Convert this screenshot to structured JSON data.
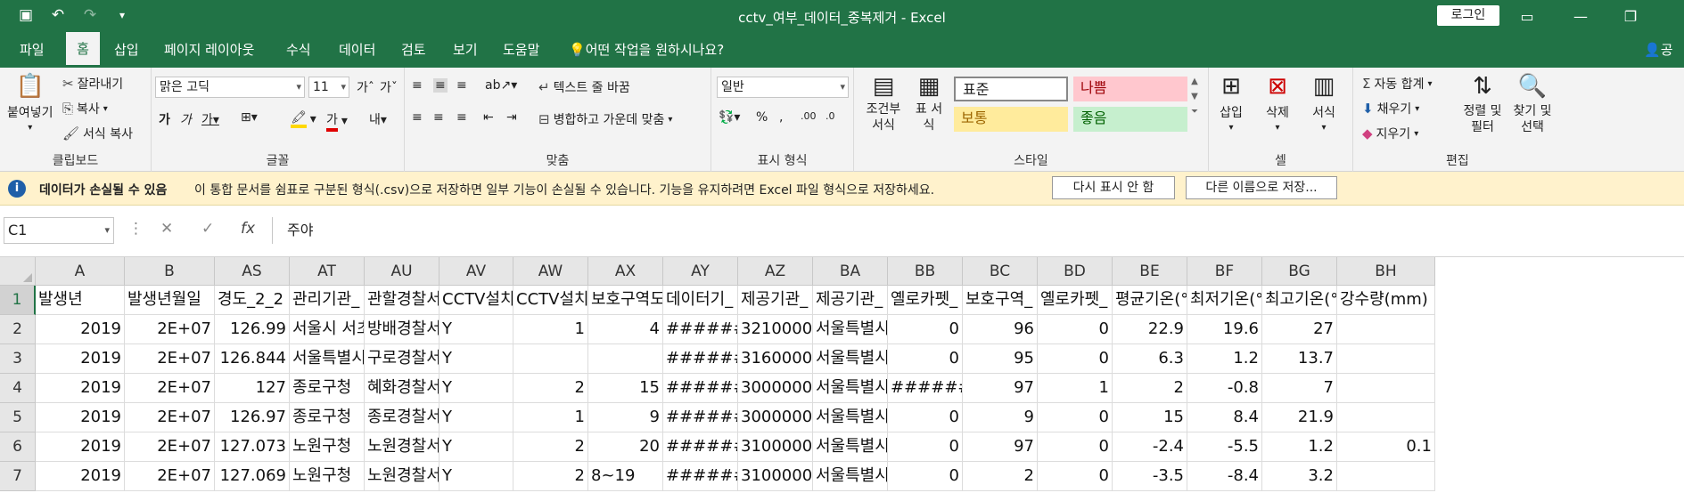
{
  "window": {
    "title": "cctv_여부_데이터_중복제거  -  Excel",
    "login_label": "로그인",
    "qat_icons": [
      "save-icon",
      "undo-icon",
      "redo-icon",
      "customize-qat-icon"
    ]
  },
  "ribbon_tabs": [
    "파일",
    "홈",
    "삽입",
    "페이지 레이아웃",
    "수식",
    "데이터",
    "검토",
    "보기",
    "도움말",
    "어떤 작업을 원하시나요?",
    "공유"
  ],
  "active_tab": "홈",
  "ribbon": {
    "clipboard": {
      "paste": "붙여넣기",
      "cut": "잘라내기",
      "copy": "복사",
      "format_painter": "서식 복사",
      "label": "클립보드"
    },
    "font": {
      "name": "맑은 고딕",
      "size": "11",
      "label": "글꼴"
    },
    "alignment": {
      "wrap": "텍스트 줄 바꿈",
      "merge": "병합하고 가운데 맞춤",
      "label": "맞춤"
    },
    "number": {
      "format": "일반",
      "label": "표시 형식"
    },
    "styles": {
      "conditional": "조건부 서식",
      "table": "표 서식",
      "normal": "표준",
      "bad": "나쁨",
      "neutral": "보통",
      "good": "좋음",
      "label": "스타일"
    },
    "cells": {
      "insert": "삽입",
      "delete": "삭제",
      "format": "서식",
      "label": "셀"
    },
    "editing": {
      "autosum": "자동 합계",
      "fill": "채우기",
      "clear": "지우기",
      "sort": "정렬 및 필터",
      "find": "찾기 및 선택",
      "label": "편집"
    }
  },
  "message_bar": {
    "title": "데이터가 손실될 수 있음",
    "text": "이 통합 문서를 쉼표로 구분된 형식(.csv)으로 저장하면 일부 기능이 손실될 수 있습니다. 기능을 유지하려면 Excel 파일 형식으로 저장하세요.",
    "btn_dismiss": "다시 표시 안 함",
    "btn_saveas": "다른 이름으로 저장..."
  },
  "formula_bar": {
    "name_box": "C1",
    "formula": "주야"
  },
  "grid": {
    "columns": [
      "A",
      "B",
      "AS",
      "AT",
      "AU",
      "AV",
      "AW",
      "AX",
      "AY",
      "AZ",
      "BA",
      "BB",
      "BC",
      "BD",
      "BE",
      "BF",
      "BG",
      "BH"
    ],
    "rows": [
      "1",
      "2",
      "3",
      "4",
      "5",
      "6",
      "7"
    ],
    "cells": [
      [
        "발생년",
        "발생년월일",
        "경도_2_2",
        "관리기관_",
        "관할경찰서",
        "CCTV설치",
        "CCTV설치",
        "보호구역도",
        "데이터기_",
        "제공기관_",
        "제공기관_",
        "옐로카펫_",
        "보호구역_",
        "옐로카펫_",
        "평균기온(°",
        "최저기온(°",
        "최고기온(°",
        "강수량(mm)"
      ],
      [
        "2019",
        "2E+07",
        "126.99",
        "서울시 서초구",
        "방배경찰서",
        "Y",
        "1",
        "4",
        "#######",
        "3210000",
        "서울특별시",
        "0",
        "96",
        "0",
        "22.9",
        "19.6",
        "27",
        ""
      ],
      [
        "2019",
        "2E+07",
        "126.844",
        "서울특별시",
        "구로경찰서",
        "Y",
        "",
        "",
        "#######",
        "3160000",
        "서울특별시",
        "0",
        "95",
        "0",
        "6.3",
        "1.2",
        "13.7",
        ""
      ],
      [
        "2019",
        "2E+07",
        "127",
        "종로구청",
        "혜화경찰서",
        "Y",
        "2",
        "15",
        "#######",
        "3000000",
        "서울특별시",
        "#######",
        "97",
        "1",
        "2",
        "-0.8",
        "7",
        ""
      ],
      [
        "2019",
        "2E+07",
        "126.97",
        "종로구청",
        "종로경찰서",
        "Y",
        "1",
        "9",
        "#######",
        "3000000",
        "서울특별시",
        "0",
        "9",
        "0",
        "15",
        "8.4",
        "21.9",
        ""
      ],
      [
        "2019",
        "2E+07",
        "127.073",
        "노원구청",
        "노원경찰서",
        "Y",
        "2",
        "20",
        "#######",
        "3100000",
        "서울특별시",
        "0",
        "97",
        "0",
        "-2.4",
        "-5.5",
        "1.2",
        "0.1"
      ],
      [
        "2019",
        "2E+07",
        "127.069",
        "노원구청",
        "노원경찰서",
        "Y",
        "2",
        "8~19",
        "#######",
        "3100000",
        "서울특별시",
        "0",
        "2",
        "0",
        "-3.5",
        "-8.4",
        "3.2",
        ""
      ]
    ]
  }
}
